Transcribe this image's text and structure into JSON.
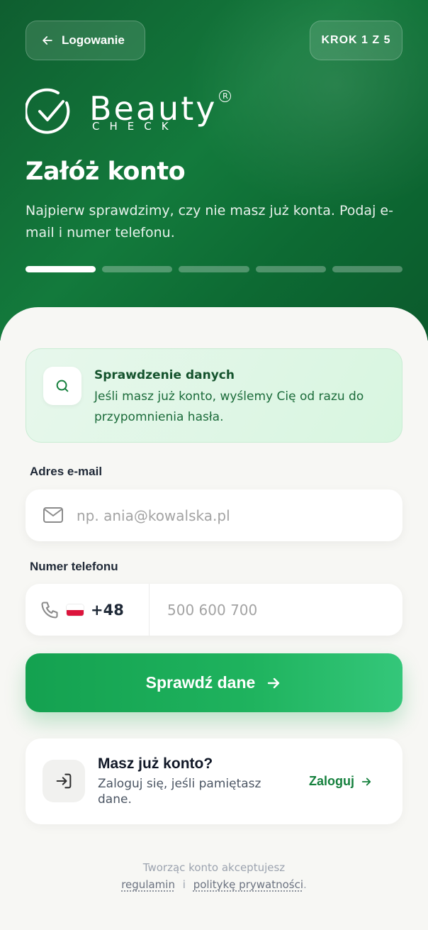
{
  "header": {
    "back_label": "Logowanie",
    "step_label": "KROK 1 Z 5",
    "brand_main": "Beauty",
    "brand_sub": "CHECK",
    "brand_reg": "R",
    "title": "Załóż konto",
    "subtitle": "Najpierw sprawdzimy, czy nie masz już konta. Podaj e-mail i numer telefonu.",
    "progress": {
      "current": 1,
      "total": 5
    }
  },
  "info_box": {
    "title": "Sprawdzenie danych",
    "body": "Jeśli masz już konto, wyślemy Cię od razu do przypomnienia hasła."
  },
  "form": {
    "email_label": "Adres e-mail",
    "email_placeholder": "np. ania@kowalska.pl",
    "email_value": "",
    "phone_label": "Numer telefonu",
    "country_code": "+48",
    "phone_placeholder": "500 600 700",
    "phone_value": ""
  },
  "cta": {
    "label": "Sprawdź dane"
  },
  "account": {
    "title": "Masz już konto?",
    "body": "Zaloguj się, jeśli pamiętasz dane.",
    "link": "Zaloguj"
  },
  "footer": {
    "line1": "Tworząc konto akceptujesz",
    "terms": "regulamin",
    "conj": "i",
    "privacy": "politykę prywatności",
    "end": "."
  },
  "colors": {
    "hero_green": "#0f6b33",
    "accent_green": "#1fb35e",
    "link_green": "#15803d"
  }
}
